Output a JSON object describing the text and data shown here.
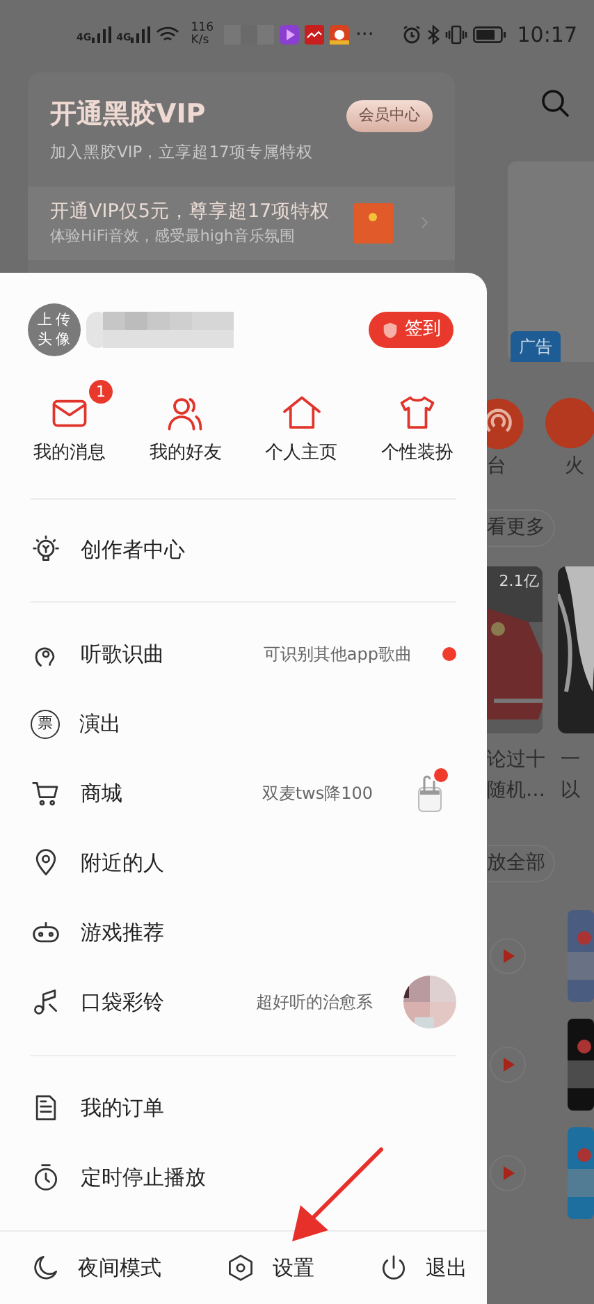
{
  "status_bar": {
    "network": [
      "4G",
      "4G"
    ],
    "speed": "116",
    "speed_unit": "K/s",
    "more": "···",
    "time": "10:17"
  },
  "vip_card": {
    "title": "开通黑胶VIP",
    "subtitle": "加入黑胶VIP，立享超17项专属特权",
    "button": "会员中心",
    "promo_title": "开通VIP仅5元，尊享超17项特权",
    "promo_subtitle": "体验HiFi音效，感受最high音乐氛围"
  },
  "drawer": {
    "avatar": "上传头像",
    "checkin": "签到",
    "shortcuts": [
      {
        "kind": "mail",
        "label": "我的消息",
        "badge": "1"
      },
      {
        "kind": "friends",
        "label": "我的好友"
      },
      {
        "kind": "home",
        "label": "个人主页"
      },
      {
        "kind": "shirt",
        "label": "个性装扮"
      }
    ],
    "menu_groups": [
      [
        {
          "kind": "bulb",
          "label": "创作者中心",
          "dot": false
        }
      ],
      [
        {
          "kind": "recognize",
          "label": "听歌识曲",
          "hint": "可识别其他app歌曲",
          "dot": true
        },
        {
          "kind": "ticket",
          "icon_text": "票",
          "label": "演出",
          "dot": false
        },
        {
          "kind": "cart",
          "label": "商城",
          "hint": "双麦tws降100",
          "thumb": true,
          "dot": true
        },
        {
          "kind": "pin",
          "label": "附近的人",
          "dot": false
        },
        {
          "kind": "gamepad",
          "label": "游戏推荐",
          "dot": false
        },
        {
          "kind": "ringtone",
          "label": "口袋彩铃",
          "hint": "超好听的治愈系",
          "thumb": true,
          "dot": false
        }
      ],
      [
        {
          "kind": "order",
          "label": "我的订单",
          "dot": false
        },
        {
          "kind": "timer",
          "label": "定时停止播放",
          "dot": false
        }
      ]
    ],
    "bottom_bar": [
      {
        "kind": "moon",
        "label": "夜间模式"
      },
      {
        "kind": "settings",
        "label": "设置"
      },
      {
        "kind": "power",
        "label": "退出"
      }
    ]
  },
  "background": {
    "ad_badge": "广告",
    "apps": [
      "台",
      "火"
    ],
    "more_pill": "看更多",
    "play_count": "2.1亿",
    "titles": [
      [
        "论过十",
        "随机…"
      ],
      [
        "一",
        "以"
      ]
    ],
    "play_all_pill": "放全部"
  }
}
